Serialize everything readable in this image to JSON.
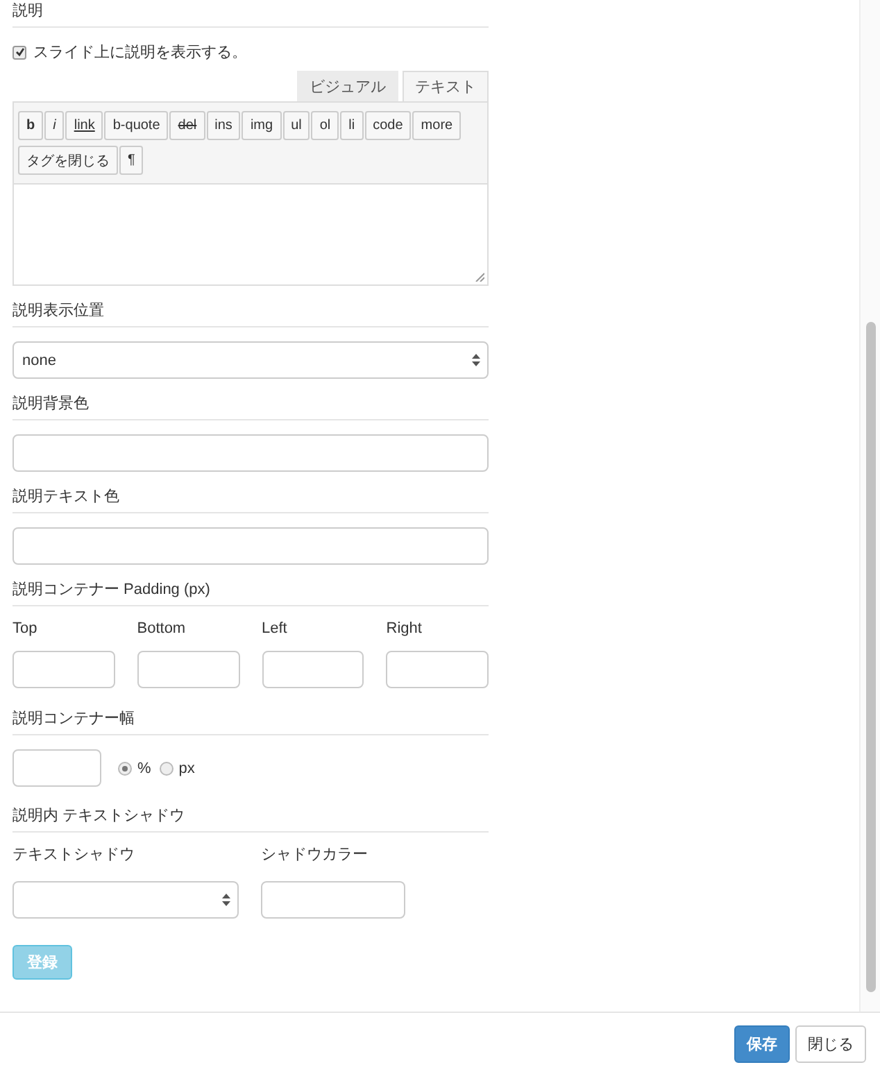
{
  "description": {
    "heading": "説明",
    "show_checkbox": {
      "label": "スライド上に説明を表示する。",
      "checked": true
    },
    "editor": {
      "tabs": [
        {
          "label": "ビジュアル",
          "selected": false
        },
        {
          "label": "テキスト",
          "selected": true
        }
      ],
      "toolbar": [
        {
          "label": "b",
          "kind": "bold"
        },
        {
          "label": "i",
          "kind": "italic"
        },
        {
          "label": "link",
          "kind": "underline"
        },
        {
          "label": "b-quote",
          "kind": "plain"
        },
        {
          "label": "del",
          "kind": "strike"
        },
        {
          "label": "ins",
          "kind": "plain"
        },
        {
          "label": "img",
          "kind": "plain"
        },
        {
          "label": "ul",
          "kind": "plain"
        },
        {
          "label": "ol",
          "kind": "plain"
        },
        {
          "label": "li",
          "kind": "plain"
        },
        {
          "label": "code",
          "kind": "plain"
        },
        {
          "label": "more",
          "kind": "plain"
        },
        {
          "label": "タグを閉じる",
          "kind": "plain"
        },
        {
          "label": "¶",
          "kind": "plain"
        }
      ]
    }
  },
  "position": {
    "heading": "説明表示位置",
    "value": "none"
  },
  "background_color": {
    "heading": "説明背景色"
  },
  "text_color": {
    "heading": "説明テキスト色"
  },
  "padding": {
    "heading": "説明コンテナー Padding (px)",
    "fields": [
      "Top",
      "Bottom",
      "Left",
      "Right"
    ]
  },
  "width": {
    "heading": "説明コンテナー幅",
    "units": [
      {
        "label": "%",
        "selected": true
      },
      {
        "label": "px",
        "selected": false
      }
    ]
  },
  "shadow": {
    "heading": "説明内 テキストシャドウ",
    "shadow_label": "テキストシャドウ",
    "color_label": "シャドウカラー"
  },
  "register_button": {
    "label": "登録",
    "disabled": true
  },
  "footer": {
    "buttons": [
      {
        "label": "保存",
        "kind": "primary"
      },
      {
        "label": "閉じる",
        "kind": "default"
      }
    ]
  }
}
